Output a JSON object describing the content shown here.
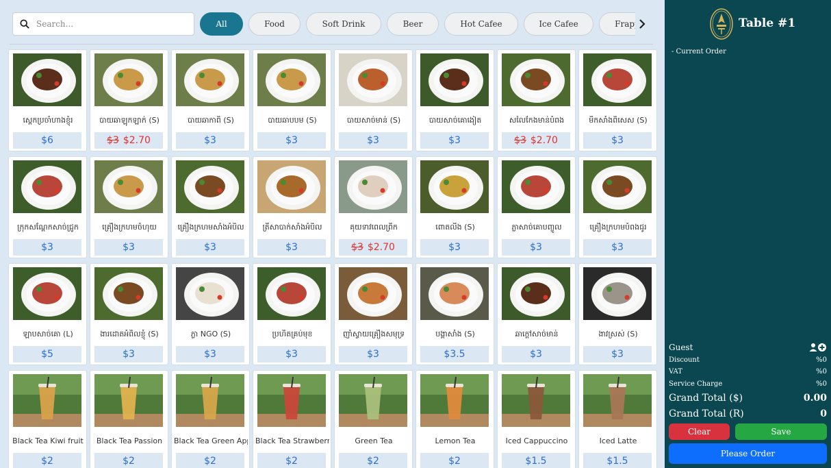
{
  "search": {
    "placeholder": "Search..."
  },
  "categories": [
    {
      "label": "All",
      "width": 63,
      "active": true
    },
    {
      "label": "Food",
      "width": 76
    },
    {
      "label": "Soft Drink",
      "width": 110
    },
    {
      "label": "Beer",
      "width": 76
    },
    {
      "label": "Hot Cafee",
      "width": 108
    },
    {
      "label": "Ice Cafee",
      "width": 102
    },
    {
      "label": "Frappe",
      "width": 90
    }
  ],
  "menu": [
    {
      "name": "ស្ពេកប្រចាំហាងខ្ញុំរ",
      "price": "$6",
      "food": "steak"
    },
    {
      "name": "បាយឆាឡុកឡាក់ (S)",
      "old": "$3",
      "price": "$2.70",
      "food": "rice"
    },
    {
      "name": "បាយឆាកាពិ (S)",
      "price": "$3",
      "food": "rice"
    },
    {
      "name": "បាយឆាបបម (S)",
      "price": "$3",
      "food": "rice"
    },
    {
      "name": "បាយសាច់មាន់ (S)",
      "price": "$3",
      "food": "chicken"
    },
    {
      "name": "បាយសាច់គោងៀត",
      "price": "$3",
      "food": "steak"
    },
    {
      "name": "សលៃកែងមាន់បំពង",
      "old": "$3",
      "price": "$2.70",
      "food": "fried"
    },
    {
      "name": "មឹកសាំងពិសេស (S)",
      "price": "$3",
      "food": "salad"
    },
    {
      "name": "ក្រុកសណ្តែកសាច់ជ្រូក",
      "price": "$3",
      "food": "salad"
    },
    {
      "name": "គ្រឿងក្រហមចំហុយ",
      "price": "$3",
      "food": "rice"
    },
    {
      "name": "គ្រឿងក្រហមសាំងអំបិល",
      "price": "$3",
      "food": "fried"
    },
    {
      "name": "ត្រីសាបាក់សាំងអំបិល",
      "price": "$3",
      "food": "fish"
    },
    {
      "name": "គុយទាវពេលព្រឹក",
      "old": "$3",
      "price": "$2.70",
      "food": "soup"
    },
    {
      "name": "ពោតលីង (S)",
      "price": "$3",
      "food": "corn"
    },
    {
      "name": "ភ្លាសាច់គោបញ្ចូល",
      "price": "$3",
      "food": "salad"
    },
    {
      "name": "គ្រឿងក្រហមបំពងជូរ",
      "price": "$3",
      "food": "fried"
    },
    {
      "name": "ឡាបសាច់គោ (L)",
      "price": "$5",
      "food": "salad"
    },
    {
      "name": "ងារដោតអំពិលខ្ញុំ (S)",
      "price": "$3",
      "food": "fried"
    },
    {
      "name": "ភ្លា NGO (S)",
      "price": "$3",
      "food": "egg"
    },
    {
      "name": "ប្រហិតគ្រប់មុខ",
      "price": "$3",
      "food": "salad"
    },
    {
      "name": "ញាំស្វាយគ្រឿងសមុទ្រ",
      "price": "$3",
      "food": "noodle"
    },
    {
      "name": "បង្គាសាំង (S)",
      "price": "$3.5",
      "food": "shrimp"
    },
    {
      "name": "ឆាក្ដៅសាច់មាន់",
      "price": "$3",
      "food": "steak"
    },
    {
      "name": "ងាវស្រស់ (S)",
      "price": "$3",
      "food": "clam"
    },
    {
      "name": "Black Tea Kiwi fruit",
      "price": "$2",
      "food": "drink",
      "drinkColor": "#d9a24b"
    },
    {
      "name": "Black Tea Passion",
      "price": "$2",
      "food": "drink",
      "drinkColor": "#e0b24e"
    },
    {
      "name": "Black Tea Green Apple",
      "price": "$2",
      "food": "drink",
      "drinkColor": "#d6a64a"
    },
    {
      "name": "Black Tea Strawberry",
      "price": "$2",
      "food": "drink",
      "drinkColor": "#c9483a"
    },
    {
      "name": "Green Tea",
      "price": "$2",
      "food": "drink",
      "drinkColor": "#a9c07a"
    },
    {
      "name": "Lemon Tea",
      "price": "$2",
      "food": "drink",
      "drinkColor": "#e08a3c"
    },
    {
      "name": "Iced Cappuccino",
      "price": "$1.5",
      "food": "drink",
      "drinkColor": "#8a5a3a"
    },
    {
      "name": "Iced Latte",
      "price": "$1.5",
      "food": "drink",
      "drinkColor": "#a87755"
    }
  ],
  "panel": {
    "title": "Table #1",
    "current_order": "- Current Order",
    "guest": "Guest",
    "discount_label": "Discount",
    "discount_value": "%0",
    "vat_label": "VAT",
    "vat_value": "%0",
    "service_label": "Service Charge",
    "service_value": "%0",
    "grand_usd_label": "Grand Total ($)",
    "grand_usd_value": "0.00",
    "grand_riel_label": "Grand Total (R)",
    "grand_riel_value": "0",
    "clear_label": "Clear",
    "save_label": "Save",
    "order_label": "Please Order"
  },
  "colors": {
    "accent": "#1a7590",
    "panel_bg": "#0b4750",
    "price": "#2a6fd0",
    "discount": "#e0312e",
    "clear": "#d9323f",
    "save": "#25a744",
    "order": "#0d6efd"
  }
}
